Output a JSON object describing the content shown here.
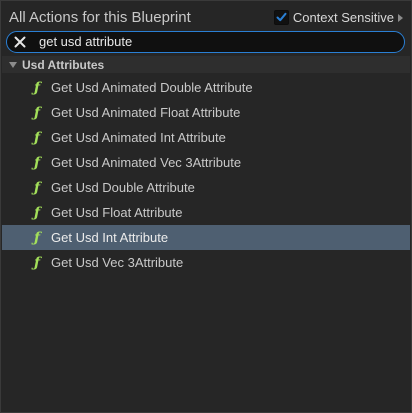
{
  "header": {
    "title": "All Actions for this Blueprint",
    "context_sensitive_label": "Context Sensitive",
    "context_sensitive_checked": true
  },
  "search": {
    "value": "get usd attribute",
    "placeholder": ""
  },
  "category": {
    "label": "Usd Attributes",
    "expanded": true
  },
  "items": [
    {
      "icon": "function-icon",
      "label": "Get Usd Animated Double Attribute",
      "selected": false
    },
    {
      "icon": "function-icon",
      "label": "Get Usd Animated Float Attribute",
      "selected": false
    },
    {
      "icon": "function-icon",
      "label": "Get Usd Animated Int Attribute",
      "selected": false
    },
    {
      "icon": "function-icon",
      "label": "Get Usd Animated Vec 3Attribute",
      "selected": false
    },
    {
      "icon": "function-icon",
      "label": "Get Usd Double Attribute",
      "selected": false
    },
    {
      "icon": "function-icon",
      "label": "Get Usd Float Attribute",
      "selected": false
    },
    {
      "icon": "function-icon",
      "label": "Get Usd Int Attribute",
      "selected": true
    },
    {
      "icon": "function-icon",
      "label": "Get Usd Vec 3Attribute",
      "selected": false
    }
  ],
  "colors": {
    "panel_background": "#262626",
    "search_border": "#2a7fd4",
    "selection": "#4e5f71",
    "function_icon": "#a3e05a",
    "checkbox_check": "#2a7fd4"
  }
}
